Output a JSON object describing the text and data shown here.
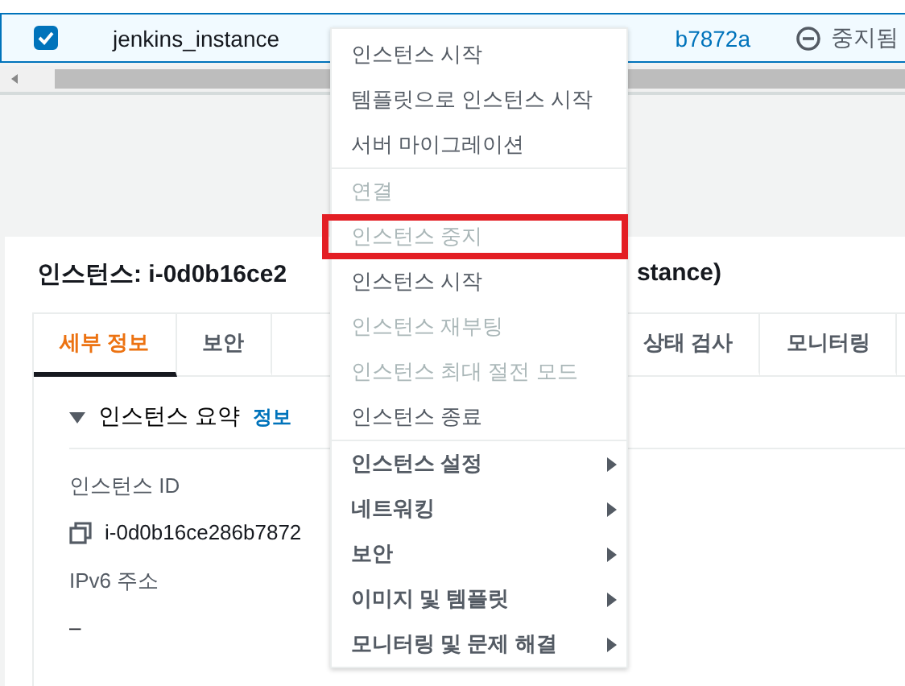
{
  "table_row": {
    "checked": true,
    "name": "jenkins_instance",
    "instance_id": "b7872a",
    "state": "중지됨"
  },
  "details": {
    "title": "인스턴스: i-0d0b16ce2",
    "title_tail": "stance)",
    "tabs": [
      {
        "label": "세부 정보",
        "selected": true
      },
      {
        "label": "보안",
        "selected": false
      },
      {
        "label": "상태 검사",
        "selected": false
      },
      {
        "label": "모니터링",
        "selected": false
      }
    ],
    "section": {
      "expanded": true,
      "title": "인스턴스 요약",
      "info_link": "정보"
    },
    "fields": [
      {
        "label": "인스턴스 ID",
        "value": "i-0d0b16ce286b7872",
        "copyable": true
      },
      {
        "label": "IPv6 주소",
        "value": "–",
        "copyable": false
      }
    ]
  },
  "context_menu": {
    "groups": [
      [
        {
          "label": "인스턴스 시작",
          "kind": "item",
          "disabled": false,
          "highlighted": false
        },
        {
          "label": "템플릿으로 인스턴스 시작",
          "kind": "item",
          "disabled": false,
          "highlighted": false
        },
        {
          "label": "서버 마이그레이션",
          "kind": "item",
          "disabled": false,
          "highlighted": false
        }
      ],
      [
        {
          "label": "연결",
          "kind": "item",
          "disabled": true,
          "highlighted": false
        },
        {
          "label": "인스턴스 중지",
          "kind": "item",
          "disabled": true,
          "highlighted": true
        },
        {
          "label": "인스턴스 시작",
          "kind": "item",
          "disabled": false,
          "highlighted": false
        },
        {
          "label": "인스턴스 재부팅",
          "kind": "item",
          "disabled": true,
          "highlighted": false
        },
        {
          "label": "인스턴스 최대 절전 모드",
          "kind": "item",
          "disabled": true,
          "highlighted": false
        },
        {
          "label": "인스턴스 종료",
          "kind": "item",
          "disabled": false,
          "highlighted": false
        }
      ],
      [
        {
          "label": "인스턴스 설정",
          "kind": "submenu",
          "disabled": false,
          "highlighted": false
        },
        {
          "label": "네트워킹",
          "kind": "submenu",
          "disabled": false,
          "highlighted": false
        },
        {
          "label": "보안",
          "kind": "submenu",
          "disabled": false,
          "highlighted": false
        },
        {
          "label": "이미지 및 템플릿",
          "kind": "submenu",
          "disabled": false,
          "highlighted": false
        },
        {
          "label": "모니터링 및 문제 해결",
          "kind": "submenu",
          "disabled": false,
          "highlighted": false
        }
      ]
    ]
  }
}
